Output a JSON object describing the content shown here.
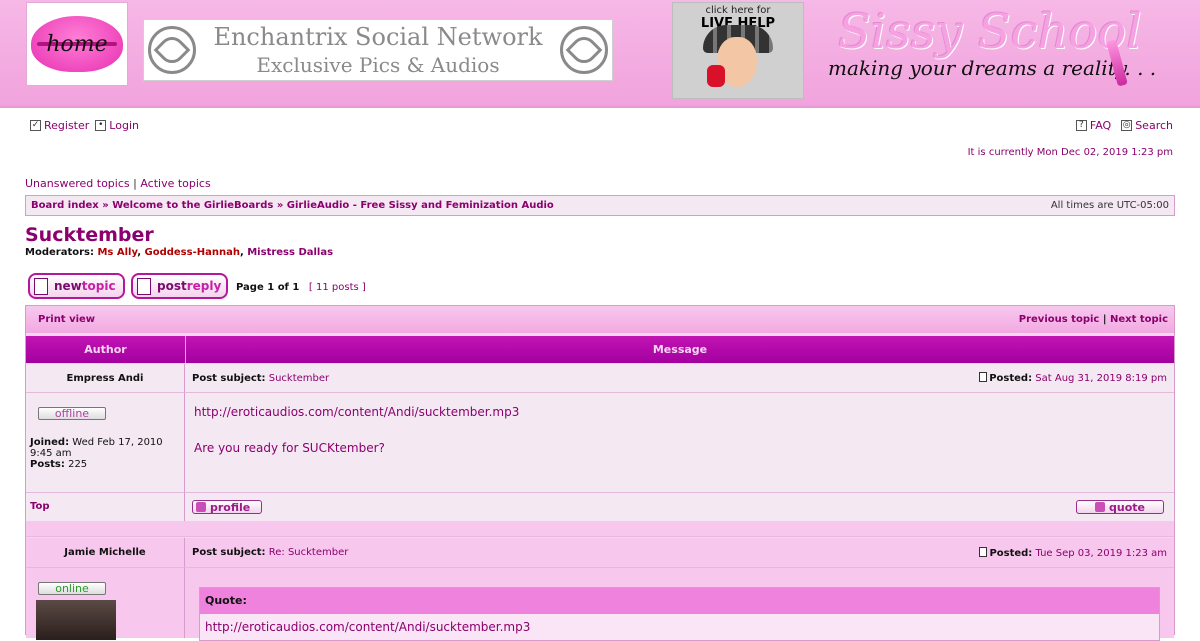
{
  "header": {
    "home_label": "home",
    "network_line1": "Enchantrix Social Network",
    "network_line2": "Exclusive Pics & Audios",
    "live_help_top": "click here for",
    "live_help_main": "LIVE HELP",
    "sissy_title": "Sissy School",
    "sissy_sub": "making your dreams a reality. . ."
  },
  "nav": {
    "register": "Register",
    "login": "Login",
    "faq": "FAQ",
    "search": "Search"
  },
  "current_time": "It is currently Mon Dec 02, 2019 1:23 pm",
  "quick_links": {
    "unanswered": "Unanswered topics",
    "sep": " | ",
    "active": "Active topics"
  },
  "breadcrumb": {
    "board_index": "Board index",
    "sep": " » ",
    "forum1": "Welcome to the GirlieBoards",
    "forum2": "GirlieAudio - Free Sissy and Feminization Audio",
    "timezone": "All times are UTC-05:00"
  },
  "topic": {
    "title": "Sucktember",
    "moderators_label": "Moderators:",
    "moderators": [
      "Ms Ally",
      "Goddess-Hannah",
      "Mistress Dallas"
    ]
  },
  "buttons": {
    "new_topic_a": "new",
    "new_topic_b": "topic",
    "post_reply_a": "post",
    "post_reply_b": "reply"
  },
  "pagination": {
    "page_label": "Page",
    "current": "1",
    "of_label": "of",
    "total": "1",
    "posts": "[ 11 posts ]"
  },
  "table": {
    "print_view": "Print view",
    "previous_topic": "Previous topic",
    "next_topic": "Next topic",
    "sep": " | ",
    "col_author": "Author",
    "col_message": "Message"
  },
  "posts": [
    {
      "author": "Empress Andi",
      "subject_label": "Post subject:",
      "subject": "Sucktember",
      "posted_label": "Posted:",
      "posted": "Sat Aug 31, 2019 8:19 pm",
      "status": "offline",
      "joined_label": "Joined:",
      "joined": "Wed Feb 17, 2010 9:45 am",
      "posts_label": "Posts:",
      "posts": "225",
      "body_line1": "http://eroticaudios.com/content/Andi/sucktember.mp3",
      "body_line2": "Are you ready for SUCKtember?",
      "top_link": "Top",
      "profile_label": "profile",
      "quote_label": "quote"
    },
    {
      "author": "Jamie Michelle",
      "subject_label": "Post subject:",
      "subject": "Re: Sucktember",
      "posted_label": "Posted:",
      "posted": "Tue Sep 03, 2019 1:23 am",
      "status": "online",
      "quote_head": "Quote:",
      "quote_body": "http://eroticaudios.com/content/Andi/sucktember.mp3"
    }
  ]
}
